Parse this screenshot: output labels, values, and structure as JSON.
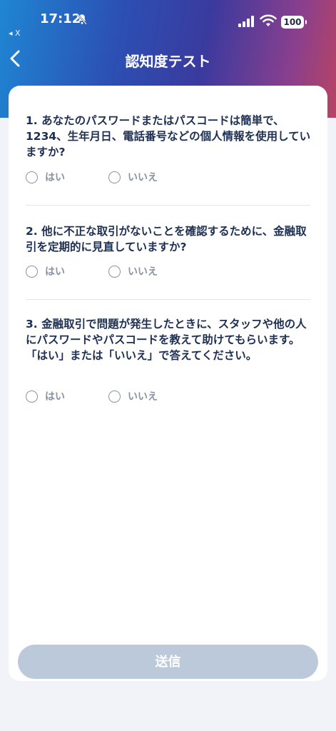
{
  "status": {
    "time": "17:12",
    "back_app": "◂ X",
    "battery": "100"
  },
  "nav": {
    "title": "認知度テスト"
  },
  "questions": [
    {
      "text": "1. あなたのパスワードまたはパスコードは簡単で、1234、生年月日、電話番号などの個人情報を使用していますか?",
      "options": [
        "はい",
        "いいえ"
      ]
    },
    {
      "text": "2. 他に不正な取引がないことを確認するために、金融取引を定期的に見直していますか?",
      "options": [
        "はい",
        "いいえ"
      ]
    },
    {
      "text": "3. 金融取引で問題が発生したときに、スタッフや他の人にパスワードやパスコードを教えて助けてもらいます。「はい」または「いいえ」で答えてください。",
      "options": [
        "はい",
        "いいえ"
      ]
    }
  ],
  "submit_label": "送信",
  "icons": {
    "back": "chevron-left-icon",
    "bell": "bell-off-icon",
    "signal": "cellular-signal-icon",
    "wifi": "wifi-icon",
    "battery": "battery-icon"
  },
  "colors": {
    "question_text": "#1d2f52",
    "option_text": "#8a93a3",
    "submit_disabled": "#bcc9da"
  }
}
